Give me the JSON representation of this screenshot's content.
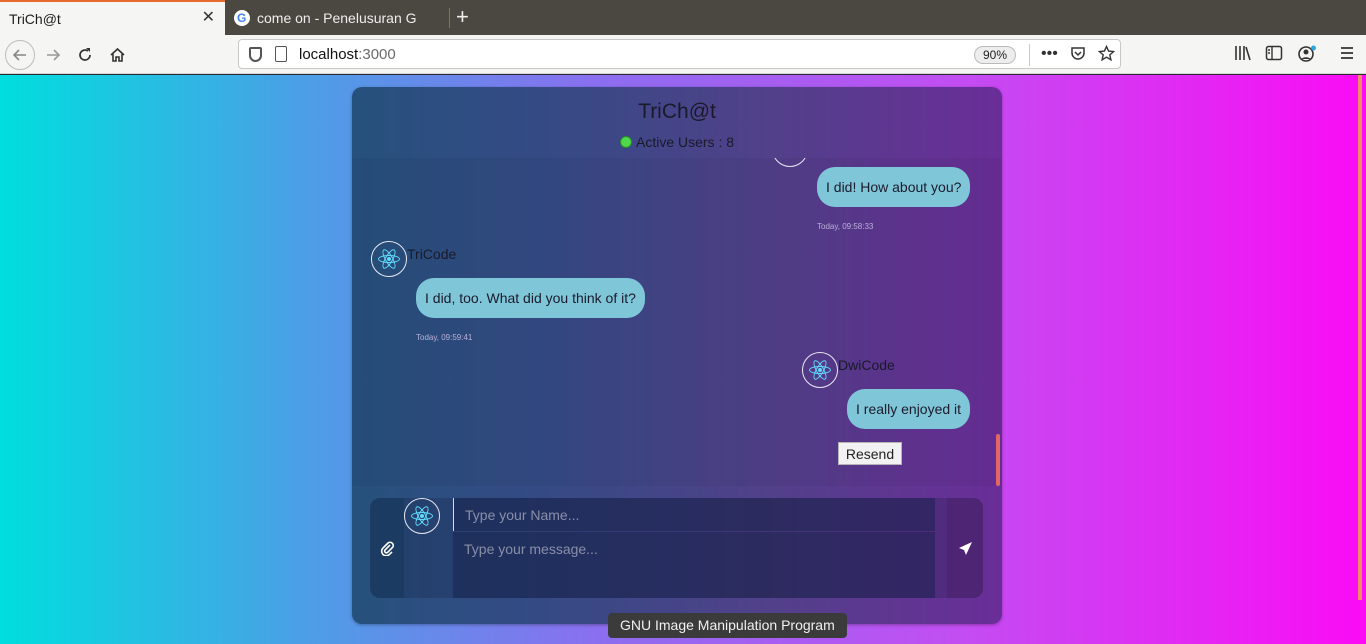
{
  "browser": {
    "tabs": [
      {
        "title": "TriCh@t",
        "active": true
      },
      {
        "title": "come on - Penelusuran G",
        "active": false
      }
    ],
    "new_tab_symbol": "+",
    "close_symbol": "✕",
    "url_host": "localhost",
    "url_port": ":3000",
    "zoom": "90%",
    "url_actions": [
      "•••",
      "pocket-icon",
      "star-icon"
    ],
    "toolbar_icons": [
      "library-icon",
      "sidebar-icon",
      "account-icon",
      "menu-icon"
    ]
  },
  "chat": {
    "title": "TriCh@t",
    "active_users": "Active Users : 8",
    "status_color": "#4dd94a",
    "messages": [
      {
        "side": "right",
        "text": "I did! How about you?",
        "time": "Today, 09:58:33"
      },
      {
        "side": "left",
        "user": "TriCode",
        "text": "I did, too. What did you think of it?",
        "time": "Today, 09:59:41"
      },
      {
        "side": "right",
        "user": "DwiCode",
        "text": "I really enjoyed it"
      }
    ],
    "resend_label": "Resend",
    "name_placeholder": "Type your Name...",
    "message_placeholder": "Type your message..."
  },
  "tooltip": "GNU Image Manipulation Program",
  "colors": {
    "bubble": "#80c6d9",
    "accent_tab": "#e66a2c",
    "gradient_left": "#00dede",
    "gradient_right": "#fb0bf4"
  }
}
